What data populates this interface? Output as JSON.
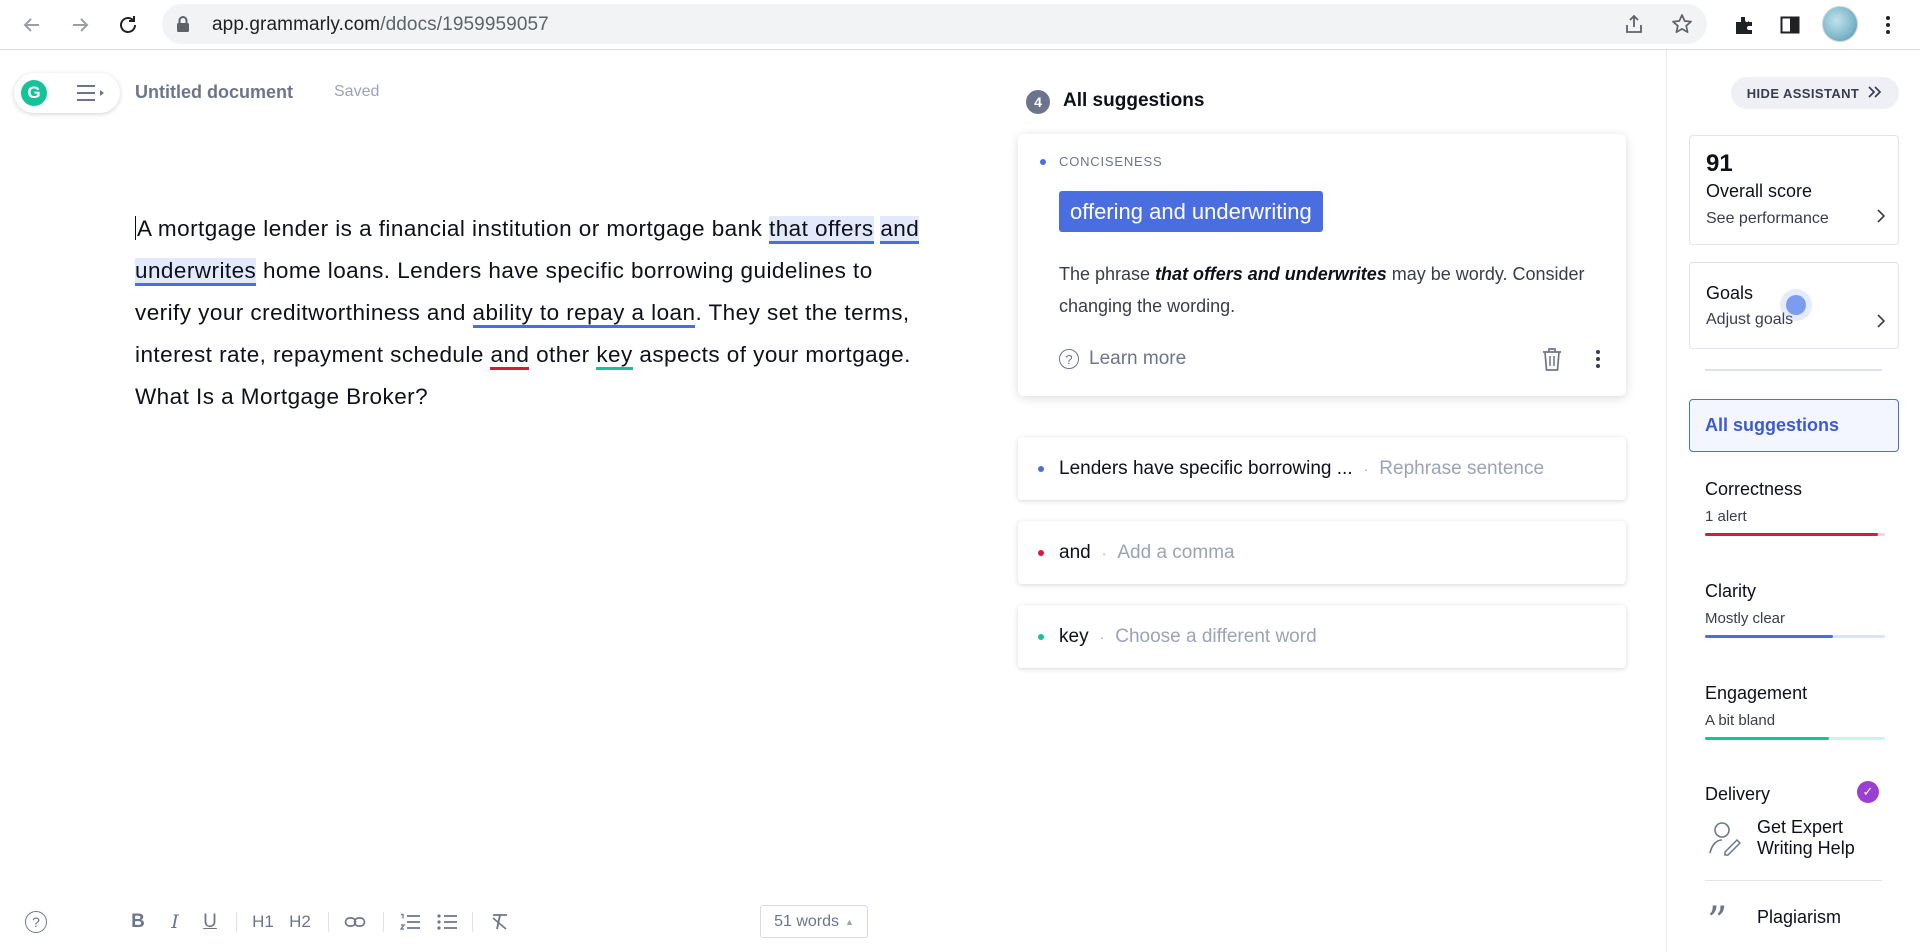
{
  "browser": {
    "url_host": "app.grammarly.com",
    "url_path": "/ddocs/1959959057"
  },
  "editor": {
    "doc_title": "Untitled document",
    "save_status": "Saved",
    "text": {
      "p1": "A mortgage lender is a financial institution or mortgage bank ",
      "h1": "that offers",
      "p2": " ",
      "h2": "and underwrites",
      "p3": " home loans. Lenders have specific borrowing guidelines to verify your creditworthiness and ",
      "u1": "ability to repay a loan",
      "p4": ". They set the terms, interest rate, repayment schedule ",
      "u2": "and",
      "p5": " other ",
      "u3": "key",
      "p6": " aspects of your mortgage. What Is a Mortgage Broker?"
    },
    "toolbar": {
      "bold": "B",
      "italic": "I",
      "underline": "U",
      "h1": "H1",
      "h2": "H2",
      "word_count": "51 words"
    }
  },
  "suggestions": {
    "count": "4",
    "header": "All suggestions",
    "active": {
      "category": "CONCISENESS",
      "replacement": "offering and underwriting",
      "explanation_pre": "The phrase ",
      "explanation_phrase": "that offers and underwrites",
      "explanation_post": " may be wordy. Consider changing the wording.",
      "learn_more": "Learn more"
    },
    "items": [
      {
        "word": "Lenders have specific borrowing ...",
        "action": "Rephrase sentence",
        "color": "#4a6ee0"
      },
      {
        "word": "and",
        "action": "Add a comma",
        "color": "#d81b3c"
      },
      {
        "word": "key",
        "action": "Choose a different word",
        "color": "#15c39a"
      }
    ]
  },
  "assistant": {
    "hide_label": "HIDE ASSISTANT",
    "score": "91",
    "score_label": "Overall score",
    "score_link": "See performance",
    "goals_title": "Goals",
    "goals_link": "Adjust goals",
    "all_suggestions": "All suggestions",
    "categories": [
      {
        "name": "Correctness",
        "status": "1 alert",
        "color": "#d81b3c",
        "track": "#f6d2d9",
        "level": 0.96
      },
      {
        "name": "Clarity",
        "status": "Mostly clear",
        "color": "#4a6ee0",
        "track": "#dbe4fa",
        "level": 0.71
      },
      {
        "name": "Engagement",
        "status": "A bit bland",
        "color": "#15c39a",
        "track": "#cdf2e8",
        "level": 0.69
      },
      {
        "name": "Delivery",
        "status": "",
        "color": "#9b3fd1",
        "track": "#e8d5f5",
        "level": 1
      }
    ],
    "expert_help": "Get Expert Writing Help",
    "plagiarism": "Plagiarism"
  }
}
